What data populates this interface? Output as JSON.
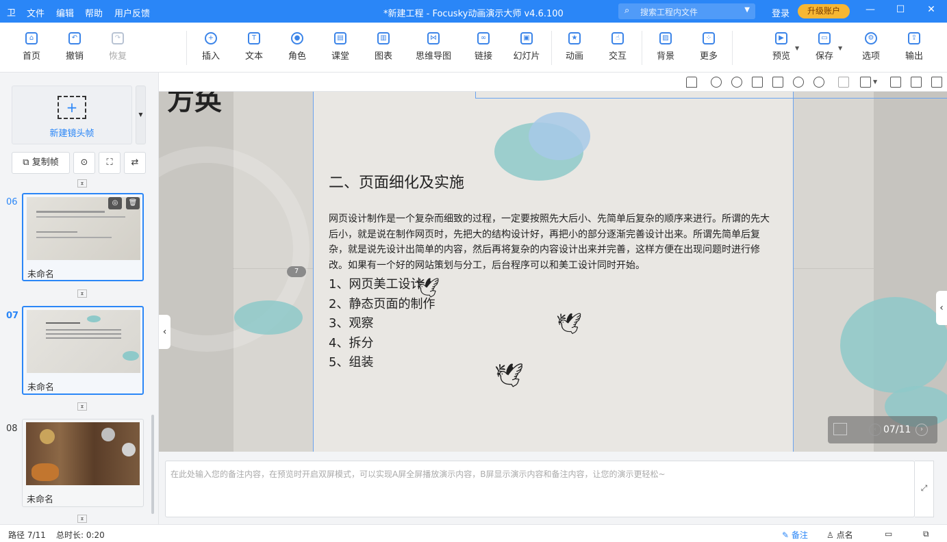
{
  "titlebar": {
    "menus": [
      "文件",
      "编辑",
      "帮助",
      "用户反馈"
    ],
    "title": "*新建工程 - Focusky动画演示大师  v4.6.100",
    "search_placeholder": "搜索工程内文件",
    "login": "登录",
    "upgrade": "升级账户"
  },
  "toolbar": {
    "home": "首页",
    "undo": "撤销",
    "redo": "恢复",
    "insert": "插入",
    "text": "文本",
    "role": "角色",
    "classroom": "课堂",
    "chart": "图表",
    "mindmap": "思维导图",
    "link": "链接",
    "slide": "幻灯片",
    "animation": "动画",
    "interaction": "交互",
    "background": "背景",
    "more": "更多",
    "preview": "预览",
    "save": "保存",
    "options": "选项",
    "export": "输出"
  },
  "leftpanel": {
    "new_frame": "新建镜头帧",
    "copy_frame": "复制帧",
    "frames": [
      {
        "num": "06",
        "name": "未命名"
      },
      {
        "num": "07",
        "name": "未命名"
      },
      {
        "num": "08",
        "name": "未命名"
      }
    ]
  },
  "slide": {
    "heading": "二、页面细化及实施",
    "paragraph": "网页设计制作是一个复杂而细致的过程，一定要按照先大后小、先简单后复杂的顺序来进行。所谓的先大后小，就是说在制作网页时，先把大的结构设计好，再把小的部分逐渐完善设计出来。所谓先简单后复杂，就是说先设计出简单的内容，然后再将复杂的内容设计出来并完善，这样方便在出现问题时进行修改。如果有一个好的网站策划与分工，后台程序可以和美工设计同时开始。",
    "list": [
      "1、网页美工设计",
      "2、静态页面的制作",
      "3、观察",
      "4、拆分",
      "5、组装"
    ],
    "frame_badge": "7",
    "offscreen_text": "方奂"
  },
  "nav": {
    "counter": "07/11"
  },
  "notes": {
    "placeholder": "在此处输入您的备注内容，在预览时开启双屏模式，可以实现A屏全屏播放演示内容，B屏显示演示内容和备注内容，让您的演示更轻松~"
  },
  "statusbar": {
    "path": "路径 7/11",
    "duration": "总时长: 0:20",
    "notes": "备注",
    "rollcall": "点名"
  }
}
